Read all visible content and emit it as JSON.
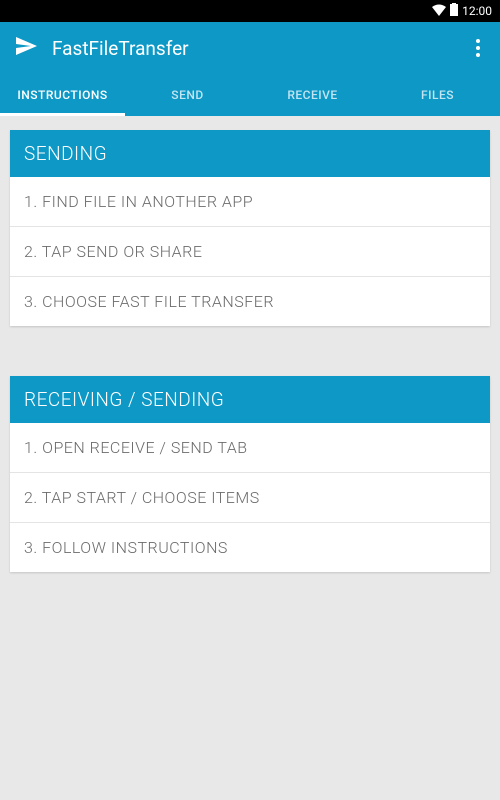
{
  "statusbar": {
    "time": "12:00"
  },
  "header": {
    "title": "FastFileTransfer"
  },
  "tabs": [
    {
      "label": "INSTRUCTIONS",
      "active": true
    },
    {
      "label": "SEND",
      "active": false
    },
    {
      "label": "RECEIVE",
      "active": false
    },
    {
      "label": "FILES",
      "active": false
    }
  ],
  "sections": [
    {
      "title": "SENDING",
      "steps": [
        "1. FIND FILE IN ANOTHER APP",
        "2. TAP SEND OR SHARE",
        "3. CHOOSE FAST FILE TRANSFER"
      ]
    },
    {
      "title": "RECEIVING / SENDING",
      "steps": [
        "1. OPEN RECEIVE / SEND TAB",
        "2. TAP START / CHOOSE ITEMS",
        "3. FOLLOW INSTRUCTIONS"
      ]
    }
  ]
}
